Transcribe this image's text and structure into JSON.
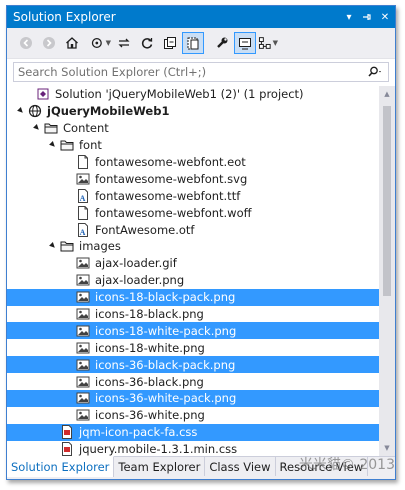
{
  "window": {
    "title": "Solution Explorer",
    "pin_glyph": "▾",
    "autohide_glyph": "⊣",
    "close_glyph": "✕"
  },
  "toolbar": {
    "icons": [
      "back-icon",
      "forward-icon",
      "home-icon",
      "sync-icon",
      "switch-views-icon",
      "refresh-icon",
      "collapse-all-icon",
      "show-all-files-icon",
      "properties-icon",
      "preview-icon",
      "class-diagram-icon"
    ]
  },
  "search": {
    "placeholder": "Search Solution Explorer (Ctrl+;)"
  },
  "tree": {
    "rows": [
      {
        "label": "Solution 'jQueryMobileWeb1 (2)' (1 project)",
        "indent": 0,
        "expander": "",
        "icon": "solution",
        "selected": false,
        "bold": false
      },
      {
        "label": "jQueryMobileWeb1",
        "indent": 0,
        "expander": "▲",
        "icon": "globe",
        "selected": false,
        "bold": true
      },
      {
        "label": "Content",
        "indent": 1,
        "expander": "▲",
        "icon": "folder",
        "selected": false,
        "bold": false
      },
      {
        "label": "font",
        "indent": 2,
        "expander": "▲",
        "icon": "folder",
        "selected": false,
        "bold": false
      },
      {
        "label": "fontawesome-webfont.eot",
        "indent": 3,
        "expander": "",
        "icon": "file",
        "selected": false,
        "bold": false
      },
      {
        "label": "fontawesome-webfont.svg",
        "indent": 3,
        "expander": "",
        "icon": "image",
        "selected": false,
        "bold": false
      },
      {
        "label": "fontawesome-webfont.ttf",
        "indent": 3,
        "expander": "",
        "icon": "font",
        "selected": false,
        "bold": false
      },
      {
        "label": "fontawesome-webfont.woff",
        "indent": 3,
        "expander": "",
        "icon": "file",
        "selected": false,
        "bold": false
      },
      {
        "label": "FontAwesome.otf",
        "indent": 3,
        "expander": "",
        "icon": "font",
        "selected": false,
        "bold": false
      },
      {
        "label": "images",
        "indent": 2,
        "expander": "▲",
        "icon": "folder",
        "selected": false,
        "bold": false
      },
      {
        "label": "ajax-loader.gif",
        "indent": 3,
        "expander": "",
        "icon": "image",
        "selected": false,
        "bold": false
      },
      {
        "label": "ajax-loader.png",
        "indent": 3,
        "expander": "",
        "icon": "image",
        "selected": false,
        "bold": false
      },
      {
        "label": "icons-18-black-pack.png",
        "indent": 3,
        "expander": "",
        "icon": "image",
        "selected": true,
        "bold": false
      },
      {
        "label": "icons-18-black.png",
        "indent": 3,
        "expander": "",
        "icon": "image",
        "selected": false,
        "bold": false
      },
      {
        "label": "icons-18-white-pack.png",
        "indent": 3,
        "expander": "",
        "icon": "image",
        "selected": true,
        "bold": false
      },
      {
        "label": "icons-18-white.png",
        "indent": 3,
        "expander": "",
        "icon": "image",
        "selected": false,
        "bold": false
      },
      {
        "label": "icons-36-black-pack.png",
        "indent": 3,
        "expander": "",
        "icon": "image",
        "selected": true,
        "bold": false
      },
      {
        "label": "icons-36-black.png",
        "indent": 3,
        "expander": "",
        "icon": "image",
        "selected": false,
        "bold": false
      },
      {
        "label": "icons-36-white-pack.png",
        "indent": 3,
        "expander": "",
        "icon": "image",
        "selected": true,
        "bold": false
      },
      {
        "label": "icons-36-white.png",
        "indent": 3,
        "expander": "",
        "icon": "image",
        "selected": false,
        "bold": false
      },
      {
        "label": "jqm-icon-pack-fa.css",
        "indent": 2,
        "expander": "",
        "icon": "css",
        "selected": true,
        "bold": false
      },
      {
        "label": "jquery.mobile-1.3.1.min.css",
        "indent": 2,
        "expander": "",
        "icon": "css",
        "selected": false,
        "bold": false
      }
    ]
  },
  "tabs": [
    {
      "label": "Solution Explorer",
      "active": true
    },
    {
      "label": "Team Explorer",
      "active": false
    },
    {
      "label": "Class View",
      "active": false
    },
    {
      "label": "Resource View",
      "active": false
    }
  ],
  "watermark": "米米貓© 2013",
  "colors": {
    "accent": "#007acc",
    "selection": "#3399ff",
    "toolbar_bg": "#eeeef2"
  }
}
